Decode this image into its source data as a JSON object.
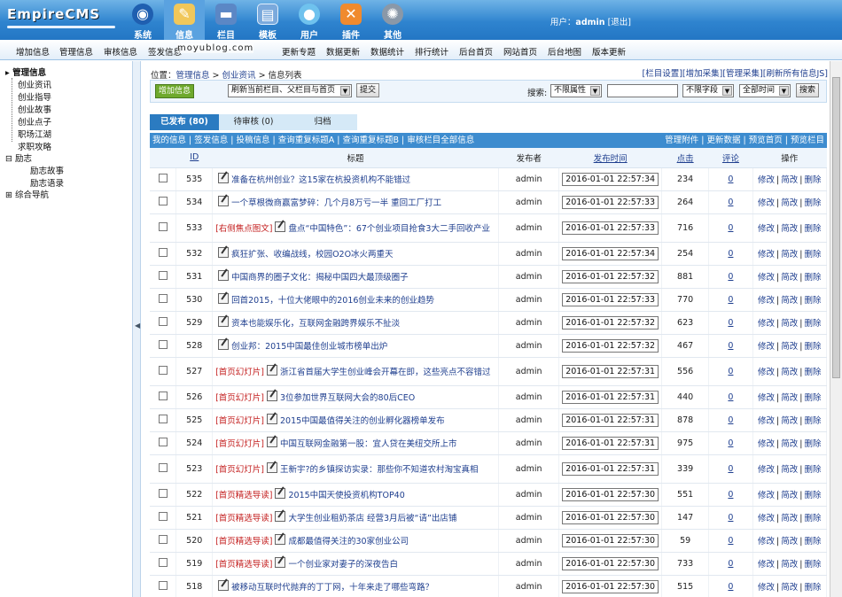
{
  "app": {
    "logo": "EmpireCMS"
  },
  "nav": [
    {
      "label": "系统",
      "icon": "globe-icon"
    },
    {
      "label": "信息",
      "icon": "notepad-icon",
      "active": true
    },
    {
      "label": "栏目",
      "icon": "folder-icon"
    },
    {
      "label": "模板",
      "icon": "window-icon"
    },
    {
      "label": "用户",
      "icon": "user-icon"
    },
    {
      "label": "插件",
      "icon": "tools-icon"
    },
    {
      "label": "其他",
      "icon": "gear-icon"
    }
  ],
  "user": {
    "prefix": "用户：",
    "name": "admin",
    "logout": "[退出]"
  },
  "subnav": [
    "增加信息",
    "管理信息",
    "审核信息",
    "签发信息",
    "",
    "更新专题",
    "数据更新",
    "数据统计",
    "排行统计",
    "后台首页",
    "网站首页",
    "后台地图",
    "版本更新"
  ],
  "watermark": "moyublog.com",
  "sidebar": {
    "root": "管理信息",
    "items": [
      "创业资讯",
      "创业指导",
      "创业故事",
      "创业点子",
      "职场江湖",
      "求职攻略"
    ],
    "group": "励志",
    "group_items": [
      "励志故事",
      "励志语录"
    ],
    "last": "综合导航"
  },
  "crumb": {
    "prefix": "位置：",
    "a": "管理信息",
    "sep": " > ",
    "b": "创业资讯",
    "c": "信息列表"
  },
  "crumb_right": [
    "[栏目设置]",
    "[增加采集]",
    "[管理采集]",
    "[刷新所有信息JS]"
  ],
  "toolbar": {
    "add": "增加信息",
    "refresh_select": "刷新当前栏目、父栏目与首页",
    "submit": "提交",
    "search_label": "搜索:",
    "attr_select": "不限属性",
    "field_select": "不限字段",
    "time_select": "全部时间",
    "search_btn": "搜索"
  },
  "tabs": [
    "已发布 (80)",
    "待审核 (0)",
    "归档"
  ],
  "actions_left": "我的信息 | 签发信息 | 投稿信息 | 查询重复标题A | 查询重复标题B | 审核栏目全部信息",
  "actions_right": "管理附件 | 更新数据 | 预览首页 | 预览栏目",
  "columns": {
    "id": "ID",
    "title": "标题",
    "author": "发布者",
    "time": "发布时间",
    "clicks": "点击",
    "comments": "评论",
    "ops": "操作"
  },
  "ops": {
    "edit": "修改",
    "simple": "简改",
    "delete": "删除"
  },
  "rows": [
    {
      "id": "535",
      "tag": "",
      "title": "准备在杭州创业？这15家在杭投资机构不能错过",
      "author": "admin",
      "time": "2016-01-01 22:57:34",
      "clicks": "234",
      "comments": "0"
    },
    {
      "id": "534",
      "tag": "",
      "title": "一个草根微商赢富梦碎：几个月8万亏一半 重回工厂打工",
      "author": "admin",
      "time": "2016-01-01 22:57:33",
      "clicks": "264",
      "comments": "0"
    },
    {
      "id": "533",
      "tag": "[右侧焦点图文]",
      "title": "盘点“中国特色”：67个创业项目抢食3大二手回收产业",
      "author": "admin",
      "time": "2016-01-01 22:57:33",
      "clicks": "716",
      "comments": "0"
    },
    {
      "id": "532",
      "tag": "",
      "title": "疯狂扩张、收编战线，校园O2O冰火两重天",
      "author": "admin",
      "time": "2016-01-01 22:57:34",
      "clicks": "254",
      "comments": "0"
    },
    {
      "id": "531",
      "tag": "",
      "title": "中国商界的圈子文化：揭秘中国四大最顶级圈子",
      "author": "admin",
      "time": "2016-01-01 22:57:32",
      "clicks": "881",
      "comments": "0"
    },
    {
      "id": "530",
      "tag": "",
      "title": "回首2015，十位大佬眼中的2016创业未来的创业趋势",
      "author": "admin",
      "time": "2016-01-01 22:57:33",
      "clicks": "770",
      "comments": "0"
    },
    {
      "id": "529",
      "tag": "",
      "title": "资本也能娱乐化，互联网金融跨界娱乐不扯淡",
      "author": "admin",
      "time": "2016-01-01 22:57:32",
      "clicks": "623",
      "comments": "0"
    },
    {
      "id": "528",
      "tag": "",
      "title": "创业邦：2015中国最佳创业城市榜单出炉",
      "author": "admin",
      "time": "2016-01-01 22:57:32",
      "clicks": "467",
      "comments": "0"
    },
    {
      "id": "527",
      "tag": "[首页幻灯片]",
      "title": "浙江省首届大学生创业峰会开幕在即，这些亮点不容错过",
      "author": "admin",
      "time": "2016-01-01 22:57:31",
      "clicks": "556",
      "comments": "0"
    },
    {
      "id": "526",
      "tag": "[首页幻灯片]",
      "title": "3位参加世界互联网大会的80后CEO",
      "author": "admin",
      "time": "2016-01-01 22:57:31",
      "clicks": "440",
      "comments": "0"
    },
    {
      "id": "525",
      "tag": "[首页幻灯片]",
      "title": "2015中国最值得关注的创业孵化器榜单发布",
      "author": "admin",
      "time": "2016-01-01 22:57:31",
      "clicks": "878",
      "comments": "0"
    },
    {
      "id": "524",
      "tag": "[首页幻灯片]",
      "title": "中国互联网金融第一股：宜人贷在美纽交所上市",
      "author": "admin",
      "time": "2016-01-01 22:57:31",
      "clicks": "975",
      "comments": "0"
    },
    {
      "id": "523",
      "tag": "[首页幻灯片]",
      "title": "王新宇?的乡镇探访实录：那些你不知道农村淘宝真相",
      "author": "admin",
      "time": "2016-01-01 22:57:31",
      "clicks": "339",
      "comments": "0"
    },
    {
      "id": "522",
      "tag": "[首页精选导读]",
      "title": "2015中国天使投资机构TOP40",
      "author": "admin",
      "time": "2016-01-01 22:57:30",
      "clicks": "551",
      "comments": "0"
    },
    {
      "id": "521",
      "tag": "[首页精选导读]",
      "title": "大学生创业租奶茶店 经营3月后被“请”出店铺",
      "author": "admin",
      "time": "2016-01-01 22:57:30",
      "clicks": "147",
      "comments": "0"
    },
    {
      "id": "520",
      "tag": "[首页精选导读]",
      "title": "成都最值得关注的30家创业公司",
      "author": "admin",
      "time": "2016-01-01 22:57:30",
      "clicks": "59",
      "comments": "0"
    },
    {
      "id": "519",
      "tag": "[首页精选导读]",
      "title": "一个创业家对妻子的深夜告白",
      "author": "admin",
      "time": "2016-01-01 22:57:30",
      "clicks": "733",
      "comments": "0"
    },
    {
      "id": "518",
      "tag": "",
      "title": "被移动互联时代抛弃的丁丁网，十年来走了哪些弯路？",
      "author": "admin",
      "time": "2016-01-01 22:57:30",
      "clicks": "515",
      "comments": "0"
    }
  ]
}
